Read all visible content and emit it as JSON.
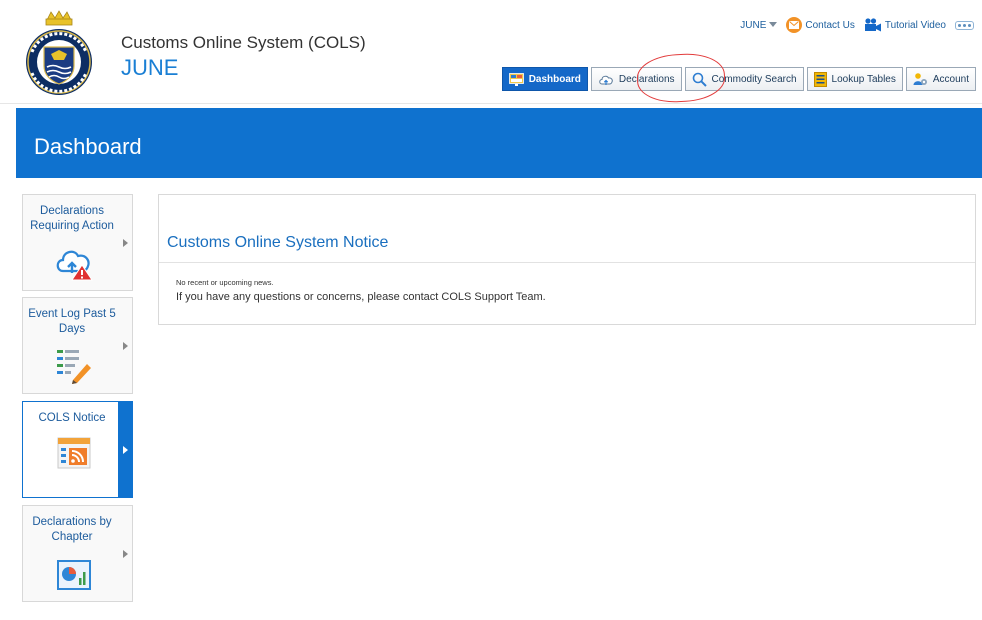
{
  "header": {
    "app_title": "Customs Online System (COLS)",
    "user_name": "JUNE"
  },
  "util_bar": {
    "user_menu": "JUNE",
    "contact_label": "Contact Us",
    "tutorial_label": "Tutorial Video"
  },
  "nav": {
    "items": [
      {
        "label": "Dashboard",
        "active": true
      },
      {
        "label": "Declarations",
        "active": false
      },
      {
        "label": "Commodity Search",
        "active": false
      },
      {
        "label": "Lookup Tables",
        "active": false
      },
      {
        "label": "Account",
        "active": false
      }
    ]
  },
  "page": {
    "title": "Dashboard"
  },
  "tiles": [
    {
      "label": "Declarations Requiring Action",
      "icon": "cloud-warning-icon",
      "active": false
    },
    {
      "label": "Event Log Past 5 Days",
      "icon": "log-edit-icon",
      "active": false
    },
    {
      "label": "COLS Notice",
      "icon": "rss-icon",
      "active": true
    },
    {
      "label": "Declarations by Chapter",
      "icon": "chart-icon",
      "active": false
    }
  ],
  "notice": {
    "title": "Customs Online System Notice",
    "news_text": "No recent or upcoming news.",
    "message": "If you have any questions or concerns, please contact COLS Support Team."
  },
  "colors": {
    "brand_blue": "#0f72cf",
    "annotation_red": "#e23b3b",
    "contact_orange": "#f29227"
  }
}
